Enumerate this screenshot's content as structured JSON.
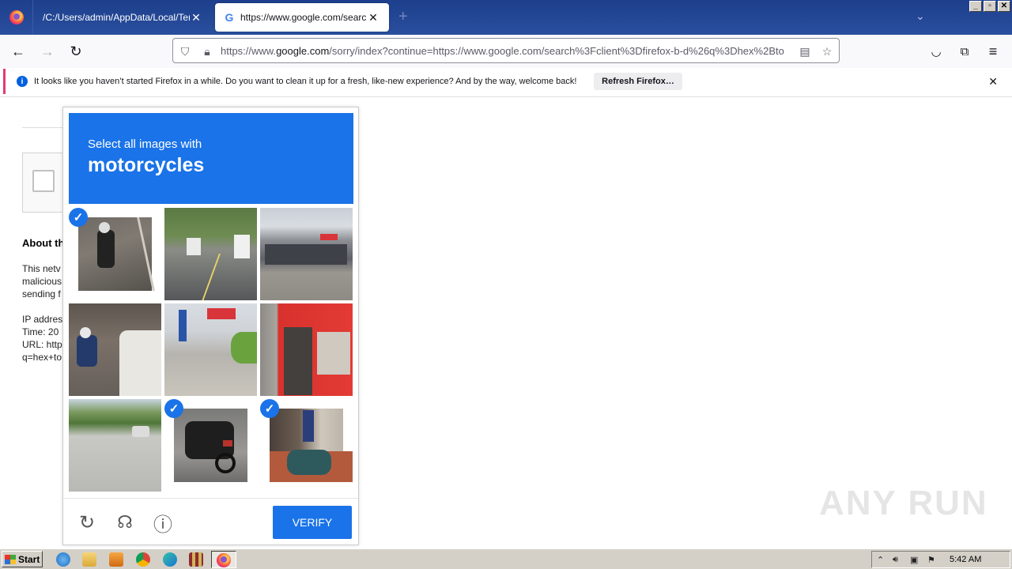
{
  "browser": {
    "tabs": [
      {
        "title": "/C:/Users/admin/AppData/Local/Temp/n"
      },
      {
        "title": "https://www.google.com/search?c"
      }
    ],
    "url": {
      "prefix": "https://www.",
      "domain": "google.com",
      "suffix": "/sorry/index?continue=https://www.google.com/search%3Fclient%3Dfirefox-b-d%26q%3Dhex%2Bto"
    }
  },
  "notification": {
    "icon": "i",
    "text": "It looks like you haven’t started Firefox in a while. Do you want to clean it up for a fresh, like-new experience? And by the way, welcome back!",
    "button": "Refresh Firefox…"
  },
  "page": {
    "about_heading": "About th",
    "lines": [
      "This netv",
      "malicious",
      "sending f",
      "IP addres",
      "Time: 20",
      "URL: http",
      "q=hex+to"
    ]
  },
  "captcha": {
    "lead": "Select all images with",
    "target": "motorcycles",
    "verify_label": "VERIFY",
    "check_glyph": "✓",
    "tiles": [
      {
        "name": "tile-1",
        "selected": true
      },
      {
        "name": "tile-2",
        "selected": false
      },
      {
        "name": "tile-3",
        "selected": false
      },
      {
        "name": "tile-4",
        "selected": false
      },
      {
        "name": "tile-5",
        "selected": false
      },
      {
        "name": "tile-6",
        "selected": false
      },
      {
        "name": "tile-7",
        "selected": false
      },
      {
        "name": "tile-8",
        "selected": true
      },
      {
        "name": "tile-9",
        "selected": true
      }
    ],
    "accent": "#1a73e8"
  },
  "watermark": "ANY RUN",
  "taskbar": {
    "start_label": "Start",
    "clock": "5:42 AM"
  }
}
